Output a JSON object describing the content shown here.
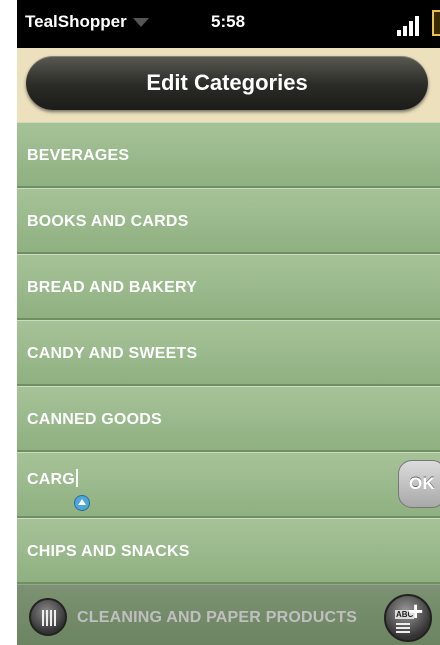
{
  "status_bar": {
    "app_name": "TealShopper",
    "time": "5:58"
  },
  "header": {
    "title": "Edit Categories"
  },
  "categories": [
    "BEVERAGES",
    "BOOKS AND CARDS",
    "BREAD AND BAKERY",
    "CANDY AND SWEETS",
    "CANNED GOODS",
    "CARG",
    "CHIPS AND SNACKS",
    "CLEANING AND PAPER PRODUCTS"
  ],
  "edit_row": {
    "value": "CARG",
    "ok_label": "OK"
  },
  "icons": {
    "app_menu": "dropdown-triangle-icon",
    "signal": "signal-strength-icon",
    "battery": "battery-icon",
    "shift": "shift-arrow-icon",
    "menu": "menu-icon",
    "add": "add-category-icon"
  }
}
